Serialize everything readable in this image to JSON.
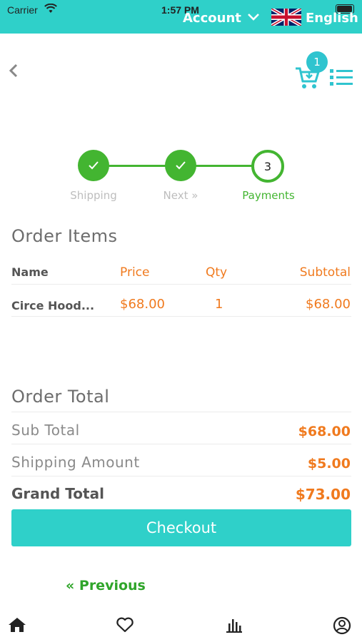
{
  "status_bar": {
    "carrier": "Carrier",
    "time": "1:57 PM"
  },
  "header": {
    "account_label": "Account",
    "language_label": "English"
  },
  "cart": {
    "count": "1"
  },
  "steps": [
    {
      "label": "Shipping",
      "state": "done"
    },
    {
      "label": "Next »",
      "state": "done"
    },
    {
      "label": "Payments",
      "number": "3",
      "state": "current"
    }
  ],
  "order_items": {
    "title": "Order Items",
    "columns": {
      "name": "Name",
      "price": "Price",
      "qty": "Qty",
      "subtotal": "Subtotal"
    },
    "rows": [
      {
        "name": "Circe Hood...",
        "price": "$68.00",
        "qty": "1",
        "subtotal": "$68.00"
      }
    ]
  },
  "order_total": {
    "title": "Order Total",
    "sub_total_label": "Sub Total",
    "sub_total_value": "$68.00",
    "shipping_label": "Shipping Amount",
    "shipping_value": "$5.00",
    "grand_total_label": "Grand Total",
    "grand_total_value": "$73.00"
  },
  "actions": {
    "checkout_label": "Checkout",
    "previous_label": "« Previous"
  },
  "colors": {
    "accent": "#2fd0c9",
    "step_green": "#43b531",
    "price_orange": "#f07a1e",
    "link_green": "#2fa52a"
  },
  "icons": [
    "wifi-icon",
    "chevron-down-icon",
    "uk-flag-icon",
    "back-chevron-icon",
    "cart-icon",
    "list-menu-icon",
    "checkmark-icon",
    "home-icon",
    "heart-icon",
    "stats-icon",
    "profile-icon"
  ]
}
